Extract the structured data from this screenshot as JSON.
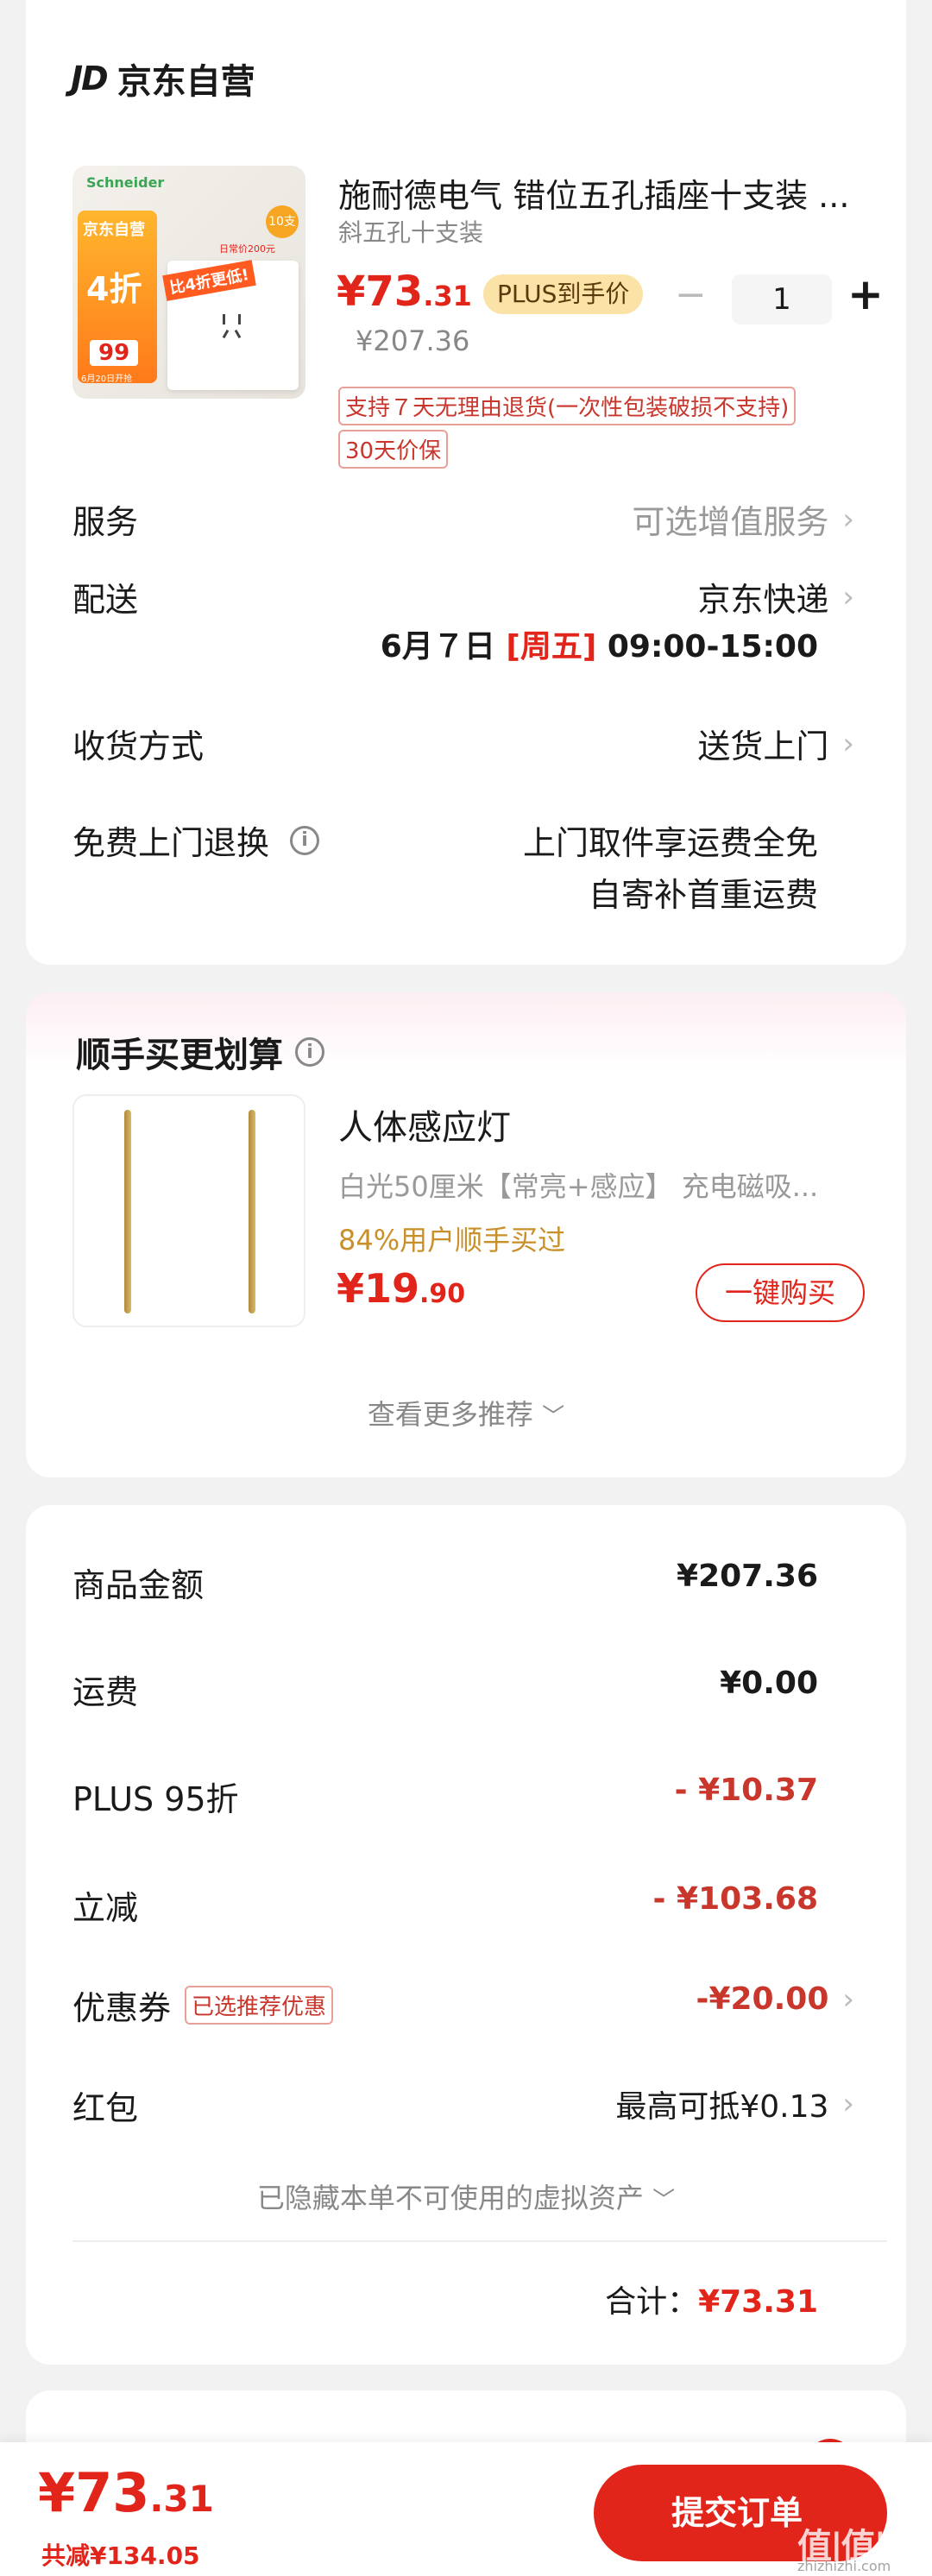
{
  "store": {
    "logo": "JD",
    "name": "京东自营"
  },
  "product": {
    "title": "施耐德电气 错位五孔插座十支装 ...",
    "spec": "斜五孔十支装",
    "price_int": "¥73",
    "price_dec": ".31",
    "plus_badge": "PLUS到手价",
    "minus": "−",
    "qty": "1",
    "plus": "+",
    "orig_price": "¥207.36",
    "tag_return": "支持７天无理由退货(一次性包装破损不支持)",
    "tag_price_protect": "30天价保",
    "thumb": {
      "brand": "Schneider",
      "count_badge": "10支",
      "banner": "京东自营",
      "discount": "4折",
      "promo": "比4折更低!",
      "promo_sub": "日常价200元",
      "price": "99",
      "date": "6月20日开抢"
    }
  },
  "service": {
    "label": "服务",
    "value": "可选增值服务"
  },
  "delivery": {
    "label": "配送",
    "value": "京东快递",
    "date": "6月７日",
    "weekday": "[周五]",
    "time": "09:00-15:00"
  },
  "receive": {
    "label": "收货方式",
    "value": "送货上门"
  },
  "free_return": {
    "label": "免费上门退换",
    "line1": "上门取件享运费全免",
    "line2": "自寄补首重运费"
  },
  "recommend": {
    "title": "顺手买更划算",
    "item_title": "人体感应灯",
    "item_spec": "白光50厘米【常亮+感应】  充电磁吸...",
    "item_social": "84%用户顺手买过",
    "price_int": "¥19",
    "price_dec": ".90",
    "buy_button": "一键购买",
    "more": "查看更多推荐"
  },
  "summary": {
    "rows": [
      {
        "label": "商品金额",
        "value": "¥207.36"
      },
      {
        "label": "运费",
        "value": "¥0.00"
      },
      {
        "label": "PLUS 95折",
        "value": "- ¥10.37"
      },
      {
        "label": "立减",
        "value": "- ¥103.68"
      },
      {
        "label": "优惠券",
        "tag": "已选推荐优惠",
        "value": "-¥20.00"
      },
      {
        "label": "红包",
        "value": "最高可抵¥0.13"
      }
    ],
    "hidden_assets": "已隐藏本单不可使用的虚拟资产",
    "total_label": "合计：",
    "total_value": "¥73.31"
  },
  "footer": {
    "price_int": "¥73",
    "price_dec": ".31",
    "saved": "共减¥134.05",
    "submit": "提交订单",
    "watermark": "值|值|值",
    "watermark_sub": "zhizhizhi.com"
  },
  "colors": {
    "accent": "#e1251b",
    "gold": "#c9902a",
    "plus_badge": "#fbe3a8"
  }
}
